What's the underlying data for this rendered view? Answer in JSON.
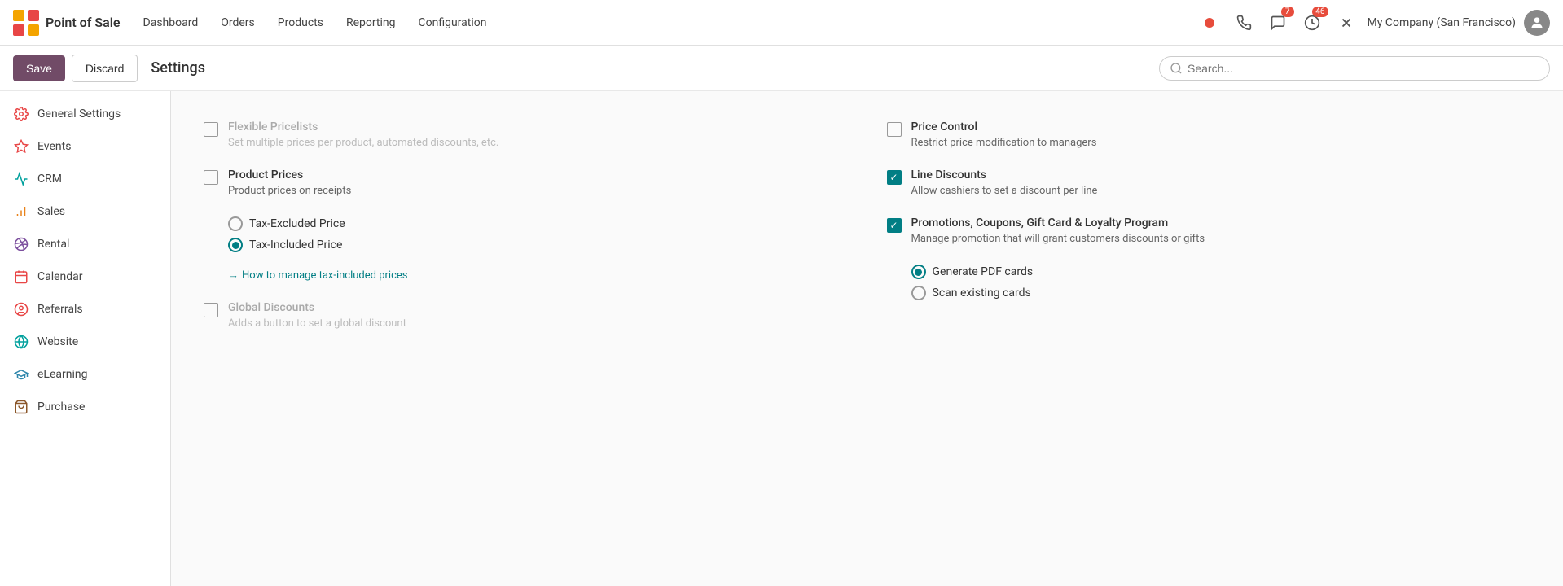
{
  "app": {
    "logo_text": "Point of Sale",
    "nav_links": [
      "Dashboard",
      "Orders",
      "Products",
      "Reporting",
      "Configuration"
    ]
  },
  "topnav_right": {
    "notifications_count": "7",
    "clock_count": "46",
    "company": "My Company (San Francisco)"
  },
  "toolbar": {
    "save_label": "Save",
    "discard_label": "Discard",
    "title": "Settings",
    "search_placeholder": "Search..."
  },
  "sidebar": {
    "items": [
      {
        "id": "general-settings",
        "label": "General Settings",
        "icon_color": "#E84646"
      },
      {
        "id": "events",
        "label": "Events",
        "icon_color": "#E84646"
      },
      {
        "id": "crm",
        "label": "CRM",
        "icon_color": "#00A09D"
      },
      {
        "id": "sales",
        "label": "Sales",
        "icon_color": "#E8821A"
      },
      {
        "id": "rental",
        "label": "Rental",
        "icon_color": "#7C4F9E"
      },
      {
        "id": "calendar",
        "label": "Calendar",
        "icon_color": "#E84646"
      },
      {
        "id": "referrals",
        "label": "Referrals",
        "icon_color": "#E84646"
      },
      {
        "id": "website",
        "label": "Website",
        "icon_color": "#00A09D"
      },
      {
        "id": "elearning",
        "label": "eLearning",
        "icon_color": "#2E86AB"
      },
      {
        "id": "purchase",
        "label": "Purchase",
        "icon_color": "#8B572A"
      }
    ]
  },
  "settings": {
    "left_column": [
      {
        "id": "flexible-pricelists",
        "title": "Flexible Pricelists",
        "desc": "Set multiple prices per product, automated discounts, etc.",
        "checked": false,
        "disabled": true
      },
      {
        "id": "product-prices",
        "title": "Product Prices",
        "desc": "Product prices on receipts",
        "checked": false,
        "disabled": false,
        "has_radio": true,
        "radio_options": [
          {
            "id": "tax-excluded",
            "label": "Tax-Excluded Price",
            "selected": false
          },
          {
            "id": "tax-included",
            "label": "Tax-Included Price",
            "selected": true
          }
        ],
        "link": {
          "text": "How to manage tax-included prices",
          "arrow": "→"
        }
      },
      {
        "id": "global-discounts",
        "title": "Global Discounts",
        "desc": "Adds a button to set a global discount",
        "checked": false,
        "disabled": true
      }
    ],
    "right_column": [
      {
        "id": "price-control",
        "title": "Price Control",
        "desc": "Restrict price modification to managers",
        "checked": false,
        "disabled": false
      },
      {
        "id": "line-discounts",
        "title": "Line Discounts",
        "desc": "Allow cashiers to set a discount per line",
        "checked": true,
        "disabled": false
      },
      {
        "id": "promotions",
        "title": "Promotions, Coupons, Gift Card & Loyalty Program",
        "desc": "Manage promotion that will grant customers discounts or gifts",
        "checked": true,
        "disabled": false,
        "has_radio": true,
        "radio_options": [
          {
            "id": "generate-pdf",
            "label": "Generate PDF cards",
            "selected": true
          },
          {
            "id": "scan-existing",
            "label": "Scan existing cards",
            "selected": false
          }
        ]
      }
    ]
  }
}
